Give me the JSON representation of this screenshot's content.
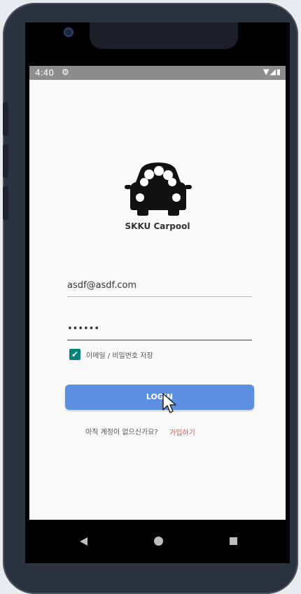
{
  "status_bar": {
    "time": "4:40",
    "settings_icon": "gear-icon",
    "system_icons": "▼◢▮"
  },
  "app": {
    "title": "SKKU Carpool",
    "logo_icon": "car-icon"
  },
  "form": {
    "email_value": "asdf@asdf.com",
    "password_value": "••••••",
    "remember_checked": true,
    "remember_label": "이메일 / 비밀번호 저장",
    "login_label": "LOGIN"
  },
  "signup": {
    "prompt": "아직 계정이 없으신가요?",
    "link": "가입하기"
  },
  "colors": {
    "accent": "#5c8fe0",
    "checkbox": "#00837a",
    "signup_link": "#d9534f"
  },
  "nav": {
    "back_icon": "back-triangle-icon",
    "home_icon": "home-circle-icon",
    "recents_icon": "recents-square-icon"
  }
}
